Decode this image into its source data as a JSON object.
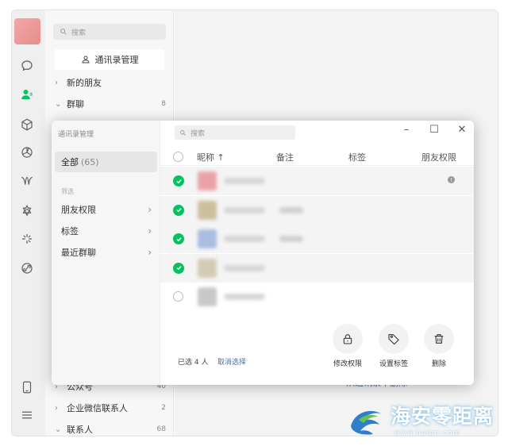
{
  "app": {
    "contacts_search_placeholder": "搜索",
    "contacts_manage_label": "通讯录管理",
    "contacts_rows": [
      {
        "label": "新的朋友",
        "count": ""
      },
      {
        "label": "群聊",
        "count": "8"
      },
      {
        "label": "公众号",
        "count": "40"
      },
      {
        "label": "企业微信联系人",
        "count": "2"
      },
      {
        "label": "联系人",
        "count": "68"
      }
    ],
    "delete_from_contacts": "从通讯录中删除"
  },
  "modal": {
    "title": "通讯录管理",
    "all_label": "全部",
    "all_count": "(65)",
    "filter_heading": "筛选",
    "filters": [
      {
        "label": "朋友权限"
      },
      {
        "label": "标签"
      },
      {
        "label": "最近群聊"
      }
    ],
    "search_placeholder": "搜索",
    "window_controls": {
      "minimize": "–",
      "maximize": "☐",
      "close": "✕"
    },
    "columns": {
      "name": "昵称 ↑",
      "note": "备注",
      "tag": "标签",
      "permission": "朋友权限"
    },
    "rows": [
      {
        "selected": true,
        "avatar_color": "#e9a3a8"
      },
      {
        "selected": true,
        "avatar_color": "#cbbf9e"
      },
      {
        "selected": true,
        "avatar_color": "#a9bde0"
      },
      {
        "selected": true,
        "avatar_color": "#d4cbb4"
      },
      {
        "selected": false,
        "avatar_color": "#c8c8c8"
      }
    ],
    "selected_text": "已选 4 人",
    "cancel_select": "取消选择",
    "actions": [
      {
        "icon": "lock-icon",
        "label": "修改权限"
      },
      {
        "icon": "tag-icon",
        "label": "设置标签"
      },
      {
        "icon": "trash-icon",
        "label": "删除"
      }
    ]
  },
  "watermark": {
    "text": "海安零距离",
    "url": "www.haian.com"
  },
  "colors": {
    "accent_green": "#07c160",
    "link_blue": "#4a6ea8"
  }
}
